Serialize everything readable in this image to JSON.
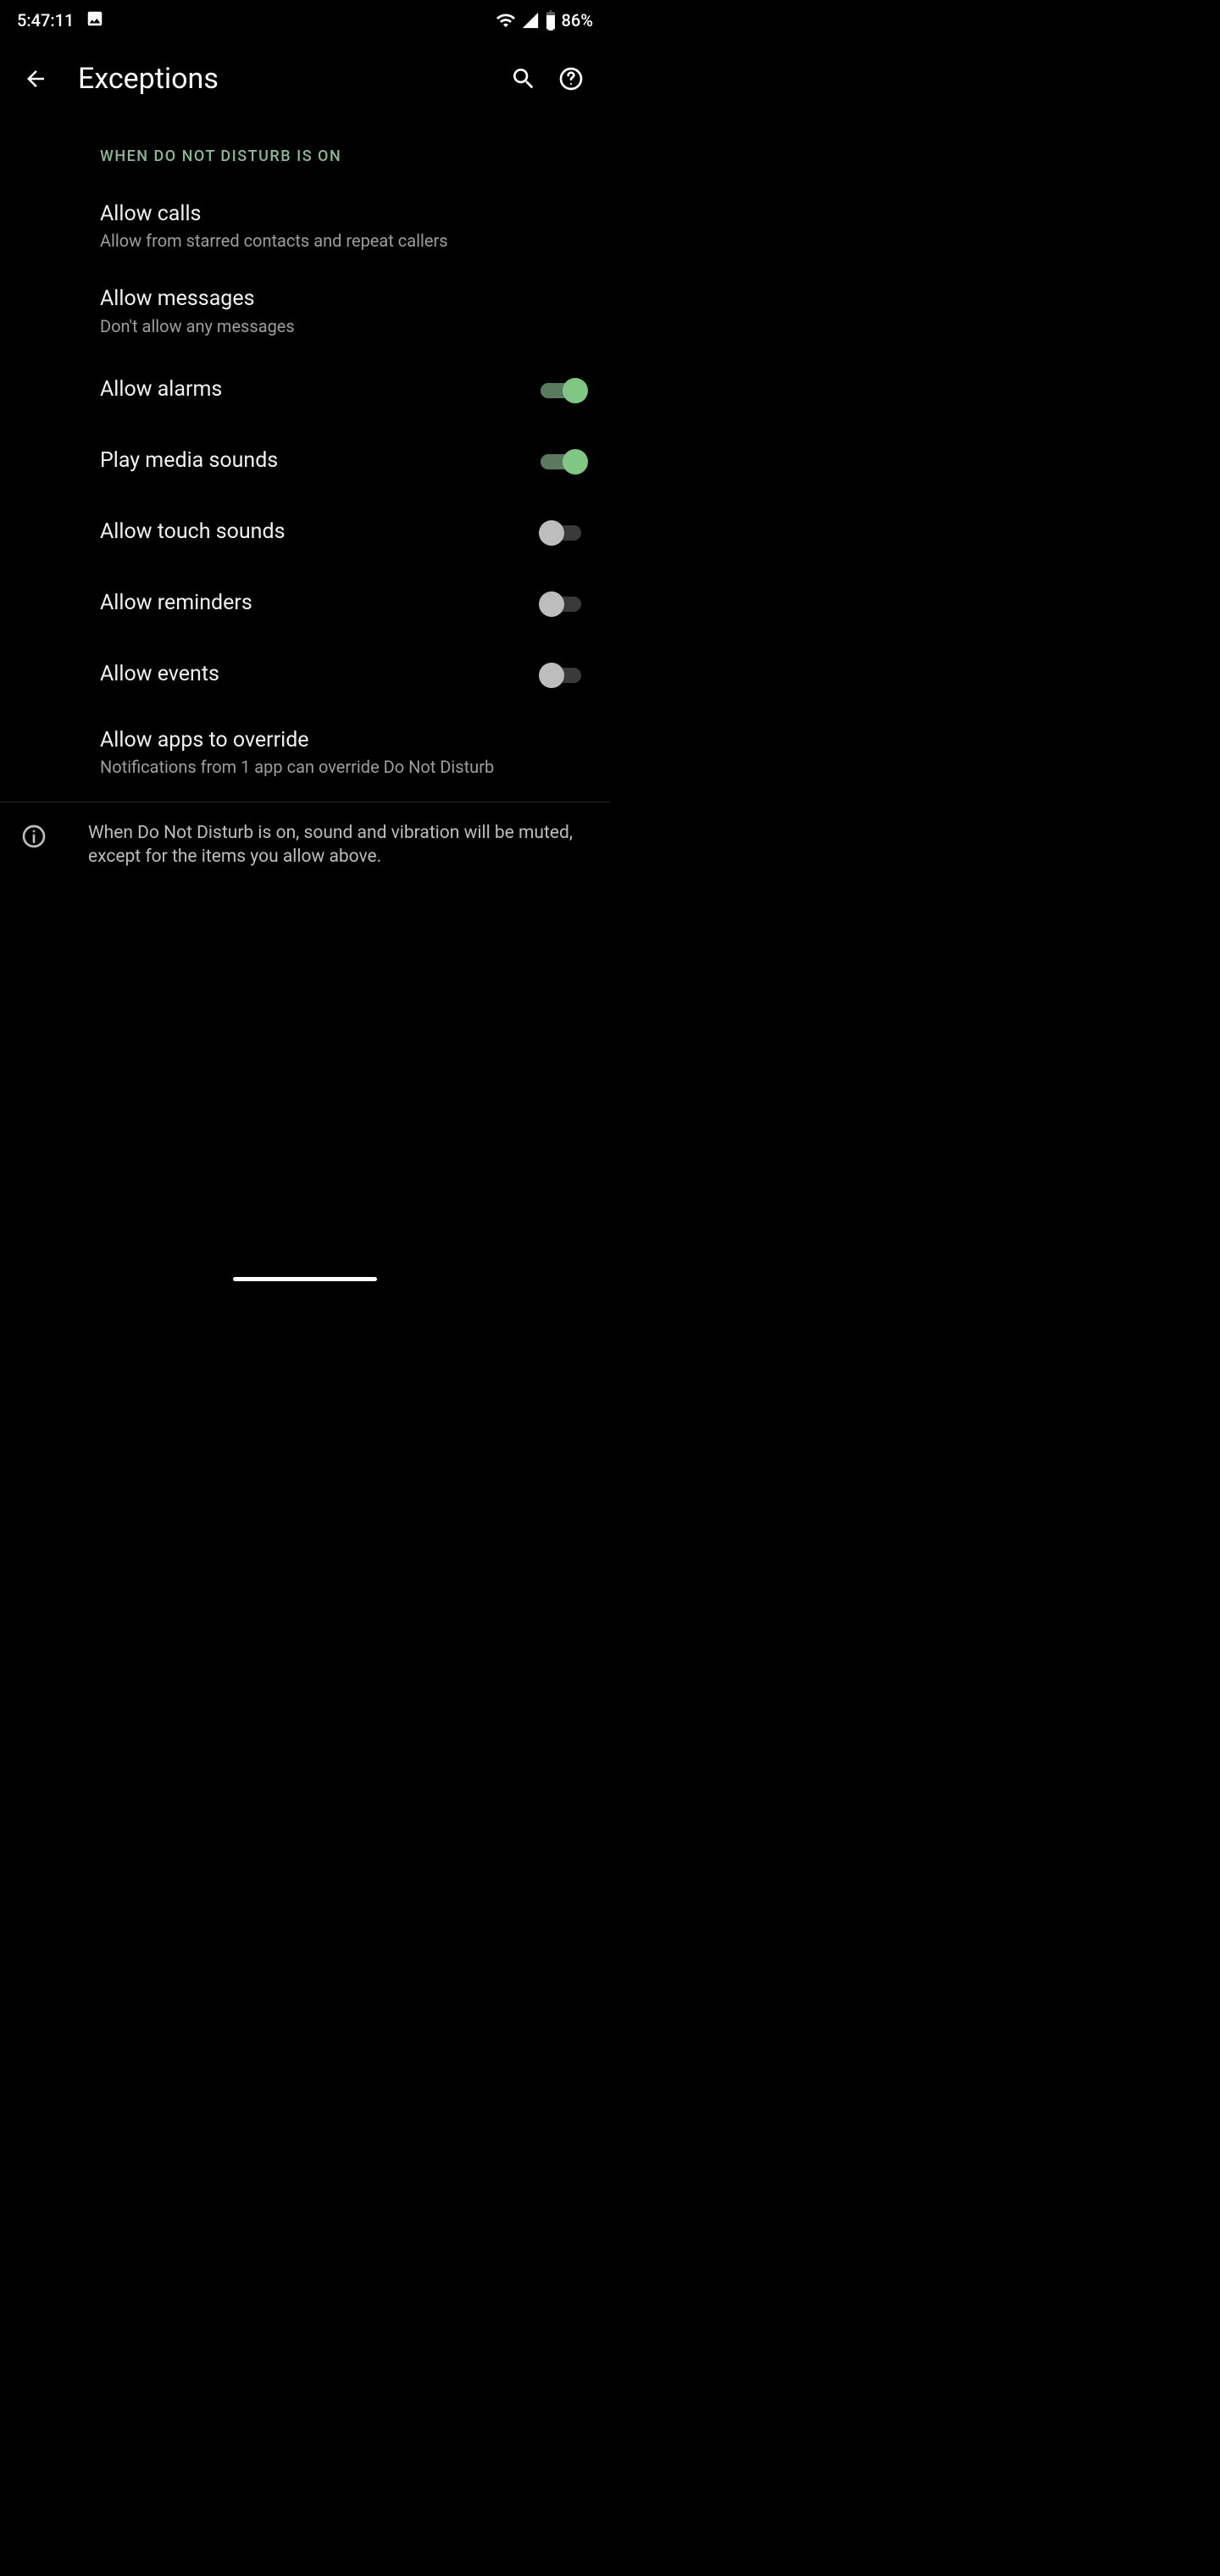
{
  "status": {
    "time": "5:47:11",
    "battery_pct": "86%"
  },
  "appbar": {
    "title": "Exceptions"
  },
  "section_header": "WHEN DO NOT DISTURB IS ON",
  "prefs": {
    "calls": {
      "title": "Allow calls",
      "summary": "Allow from starred contacts and repeat callers"
    },
    "messages": {
      "title": "Allow messages",
      "summary": "Don't allow any messages"
    },
    "alarms": {
      "title": "Allow alarms",
      "on": true
    },
    "media": {
      "title": "Play media sounds",
      "on": true
    },
    "touch": {
      "title": "Allow touch sounds",
      "on": false
    },
    "reminders": {
      "title": "Allow reminders",
      "on": false
    },
    "events": {
      "title": "Allow events",
      "on": false
    },
    "override": {
      "title": "Allow apps to override",
      "summary": "Notifications from 1 app can override Do Not Disturb"
    }
  },
  "note": "When Do Not Disturb is on, sound and vibration will be muted, except for the items you allow above.",
  "colors": {
    "accent": "#81c784",
    "section_label": "#8ab894"
  }
}
